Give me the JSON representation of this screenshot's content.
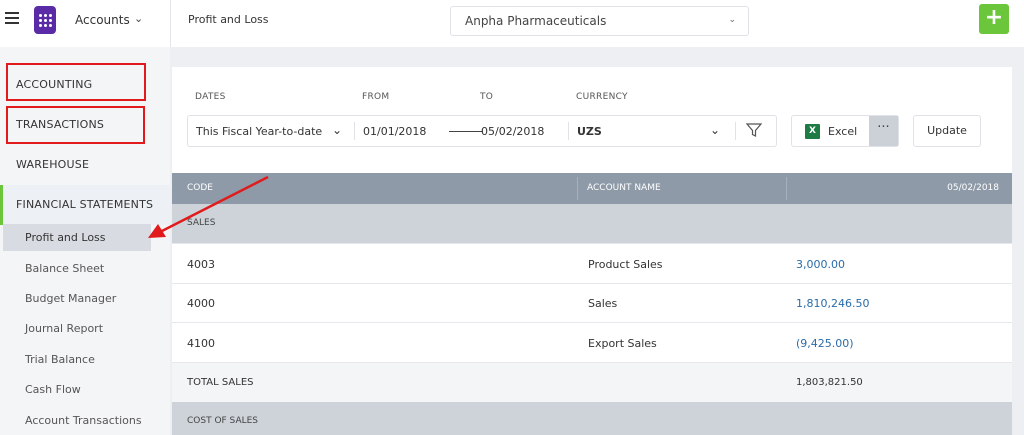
{
  "topbar": {
    "app_switcher_label": "Accounts",
    "page_title": "Profit and Loss",
    "company": "Anpha Pharmaceuticals",
    "add_label": "+"
  },
  "sidebar": {
    "sections": [
      "ACCOUNTING",
      "TRANSACTIONS",
      "WAREHOUSE",
      "FINANCIAL STATEMENTS"
    ],
    "items": [
      "Profit and Loss",
      "Balance Sheet",
      "Budget Manager",
      "Journal Report",
      "Trial Balance",
      "Cash Flow",
      "Account Transactions"
    ],
    "active_item": "Profit and Loss"
  },
  "filters": {
    "dates_label": "DATES",
    "from_label": "FROM",
    "to_label": "TO",
    "currency_label": "CURRENCY",
    "dates_value": "This Fiscal Year-to-date",
    "from_value": "01/01/2018",
    "to_value": "05/02/2018",
    "currency_value": "UZS"
  },
  "actions": {
    "excel_label": "Excel",
    "more_label": "···",
    "update_label": "Update"
  },
  "table": {
    "headers": [
      "CODE",
      "ACCOUNT NAME",
      "05/02/2018"
    ],
    "section_sales": "SALES",
    "rows": [
      {
        "code": "4003",
        "name": "Product Sales",
        "amount": "3,000.00"
      },
      {
        "code": "4000",
        "name": "Sales",
        "amount": "1,810,246.50"
      },
      {
        "code": "4100",
        "name": "Export Sales",
        "amount": "(9,425.00)"
      }
    ],
    "total_label": "TOTAL SALES",
    "total_amount": "1,803,821.50",
    "section_cost": "COST OF SALES"
  },
  "colors": {
    "accent_green": "#6bc63b",
    "annotation_red": "#e11b1b",
    "logo_purple": "#5b2aa6",
    "amount_blue": "#2a6ca8"
  }
}
